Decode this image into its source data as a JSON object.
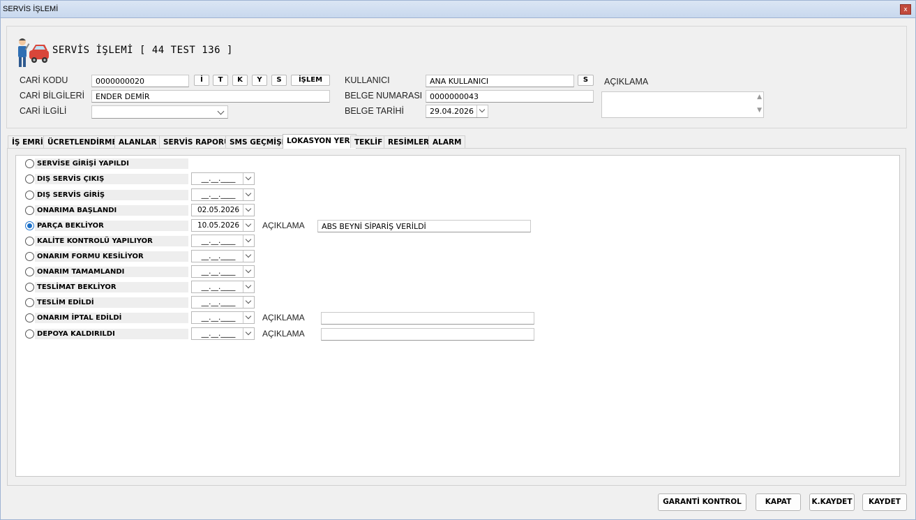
{
  "window": {
    "title": "SERVİS İŞLEMİ",
    "close": "x"
  },
  "header": {
    "title": "SERVİS İŞLEMİ [ 44 TEST 136 ]"
  },
  "form": {
    "cari_kodu": {
      "label": "CARİ KODU",
      "value": "0000000020"
    },
    "buttons": [
      "İ",
      "T",
      "K",
      "Y",
      "S",
      "İŞLEM"
    ],
    "cari_bilgileri": {
      "label": "CARİ BİLGİLERİ",
      "value": "ENDER DEMİR"
    },
    "cari_ilgili": {
      "label": "CARİ İLGİLİ",
      "value": ""
    },
    "kullanici": {
      "label": "KULLANICI",
      "value": "ANA KULLANICI",
      "button": "S"
    },
    "belge_numarasi": {
      "label": "BELGE NUMARASI",
      "value": "0000000043"
    },
    "belge_tarihi": {
      "label": "BELGE TARİHİ",
      "value": "29.04.2026"
    },
    "aciklama": {
      "label": "AÇIKLAMA",
      "value": ""
    }
  },
  "tabs": [
    {
      "label": "İŞ EMRİ"
    },
    {
      "label": "ÜCRETLENDİRME"
    },
    {
      "label": "ALANLAR"
    },
    {
      "label": "SERVİS RAPORU"
    },
    {
      "label": "SMS GEÇMİŞİ"
    },
    {
      "label": "LOKASYON YERİ",
      "active": true
    },
    {
      "label": "TEKLİF"
    },
    {
      "label": "RESİMLER"
    },
    {
      "label": "ALARM"
    }
  ],
  "locations": {
    "empty_date": "__.__.____",
    "aciklama_label": "AÇIKLAMA",
    "rows": [
      {
        "label": "SERVİSE GİRİŞİ YAPILDI",
        "selected": false
      },
      {
        "label": "DIŞ SERVİS ÇIKIŞ",
        "date": "",
        "selected": false
      },
      {
        "label": "DIŞ SERVİS GİRİŞ",
        "date": "",
        "selected": false
      },
      {
        "label": "ONARIMA BAŞLANDI",
        "date": "02.05.2026",
        "selected": false
      },
      {
        "label": "PARÇA BEKLİYOR",
        "date": "10.05.2026",
        "selected": true,
        "aciklama": "ABS BEYNİ SİPARİŞ VERİLDİ"
      },
      {
        "label": "KALİTE KONTROLÜ YAPILIYOR",
        "date": "",
        "selected": false
      },
      {
        "label": "ONARIM FORMU KESİLİYOR",
        "date": "",
        "selected": false
      },
      {
        "label": "ONARIM TAMAMLANDI",
        "date": "",
        "selected": false
      },
      {
        "label": "TESLİMAT BEKLİYOR",
        "date": "",
        "selected": false
      },
      {
        "label": "TESLİM EDİLDİ",
        "date": "",
        "selected": false
      },
      {
        "label": "ONARIM İPTAL EDİLDİ",
        "date": "",
        "selected": false,
        "aciklama": ""
      },
      {
        "label": "DEPOYA KALDIRILDI",
        "date": "",
        "selected": false,
        "aciklama": ""
      }
    ]
  },
  "footer": {
    "garanti": "GARANTİ KONTROL",
    "kapat": "KAPAT",
    "kkaydet": "K.KAYDET",
    "kaydet": "KAYDET"
  },
  "colors": {
    "accent": "#1a6fc9",
    "titlebar": "#c8d8ee",
    "close": "#c24a3d"
  },
  "icons": {
    "header": "mechanic-car-icon"
  }
}
